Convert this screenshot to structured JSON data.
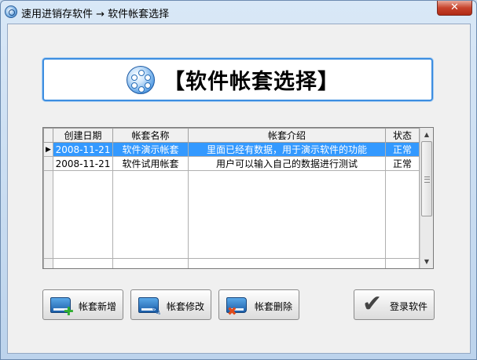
{
  "window": {
    "title": "速用进销存软件 → 软件帐套选择",
    "close_label": "✕"
  },
  "banner": {
    "title": "【软件帐套选择】"
  },
  "grid": {
    "columns": [
      "创建日期",
      "帐套名称",
      "帐套介绍",
      "状态"
    ],
    "rows": [
      {
        "date": "2008-11-21",
        "name": "软件演示帐套",
        "desc": "里面已经有数据，用于演示软件的功能",
        "status": "正常",
        "selected": true
      },
      {
        "date": "2008-11-21",
        "name": "软件试用帐套",
        "desc": "用户可以输入自己的数据进行测试",
        "status": "正常",
        "selected": false
      }
    ],
    "current_row_marker": "▶"
  },
  "buttons": {
    "add_label": "帐套新增",
    "edit_label": "帐套修改",
    "delete_label": "帐套删除",
    "login_label": "登录软件"
  },
  "colors": {
    "selection": "#3399ff",
    "banner_border": "#3d8ee0",
    "close_button": "#c7432c"
  }
}
